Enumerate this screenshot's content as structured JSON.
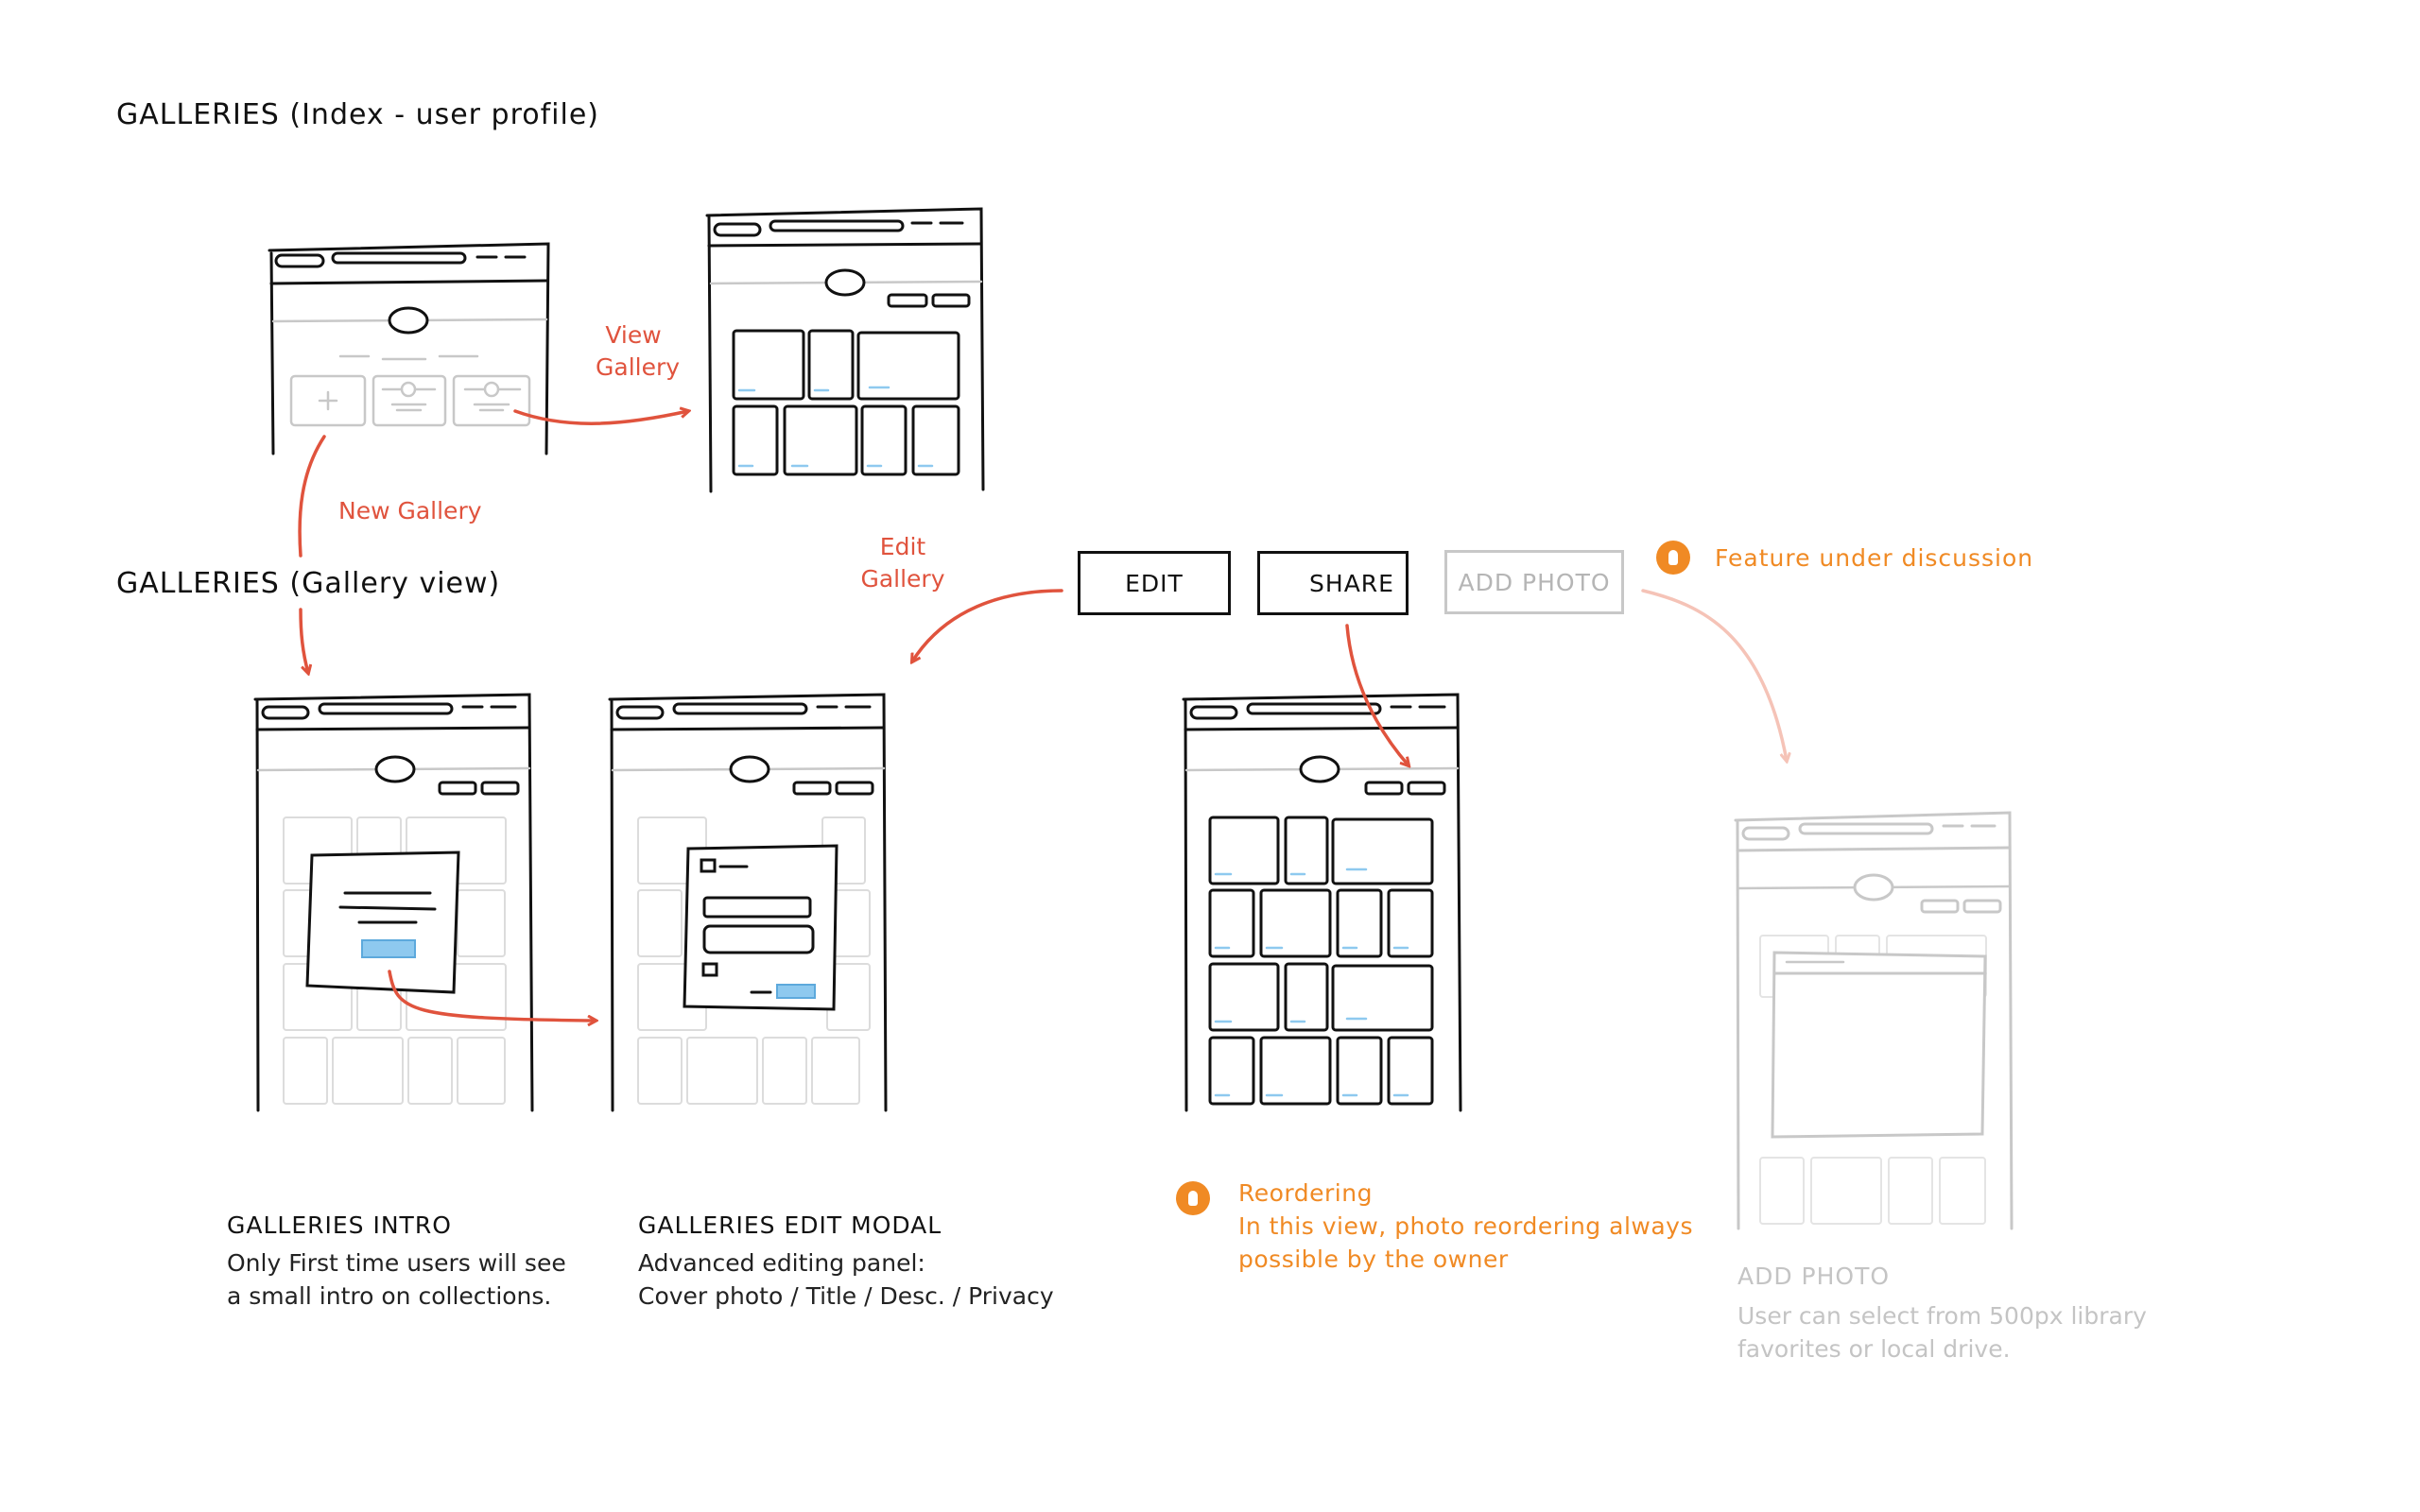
{
  "sections": {
    "index_title": "GALLERIES (Index - user profile)",
    "gallery_view_title": "GALLERIES (Gallery view)"
  },
  "flow_labels": {
    "view_gallery_line1": "View",
    "view_gallery_line2": "Gallery",
    "new_gallery": "New Gallery",
    "edit_gallery_line1": "Edit",
    "edit_gallery_line2": "Gallery"
  },
  "buttons": {
    "edit": "EDIT",
    "share": "SHARE",
    "add_photo": "ADD PHOTO"
  },
  "notes": {
    "feature": "Feature under discussion",
    "reordering_title": "Reordering",
    "reordering_line1": "In this view, photo reordering always",
    "reordering_line2": "possible by the owner"
  },
  "captions": {
    "intro": {
      "title": "GALLERIES INTRO",
      "line1": "Only First time users will see",
      "line2": "a small intro on collections."
    },
    "edit_modal": {
      "title": "GALLERIES EDIT MODAL",
      "line1": "Advanced editing panel:",
      "line2": "Cover photo /  Title / Desc. / Privacy"
    },
    "add_photo": {
      "title": "ADD PHOTO",
      "line1": "User can select from 500px library",
      "line2": "favorites or local drive."
    }
  },
  "colors": {
    "arrow": "#e0533d",
    "arrow_faded": "#f5c3b7",
    "note_orange": "#f08a24",
    "highlight_blue": "#8ec9ef",
    "sketch_line": "#111111",
    "faded_line": "#c8c8c8"
  },
  "icons": [
    "share-arrow-icon",
    "plus-icon",
    "exclamation-badge-icon"
  ]
}
